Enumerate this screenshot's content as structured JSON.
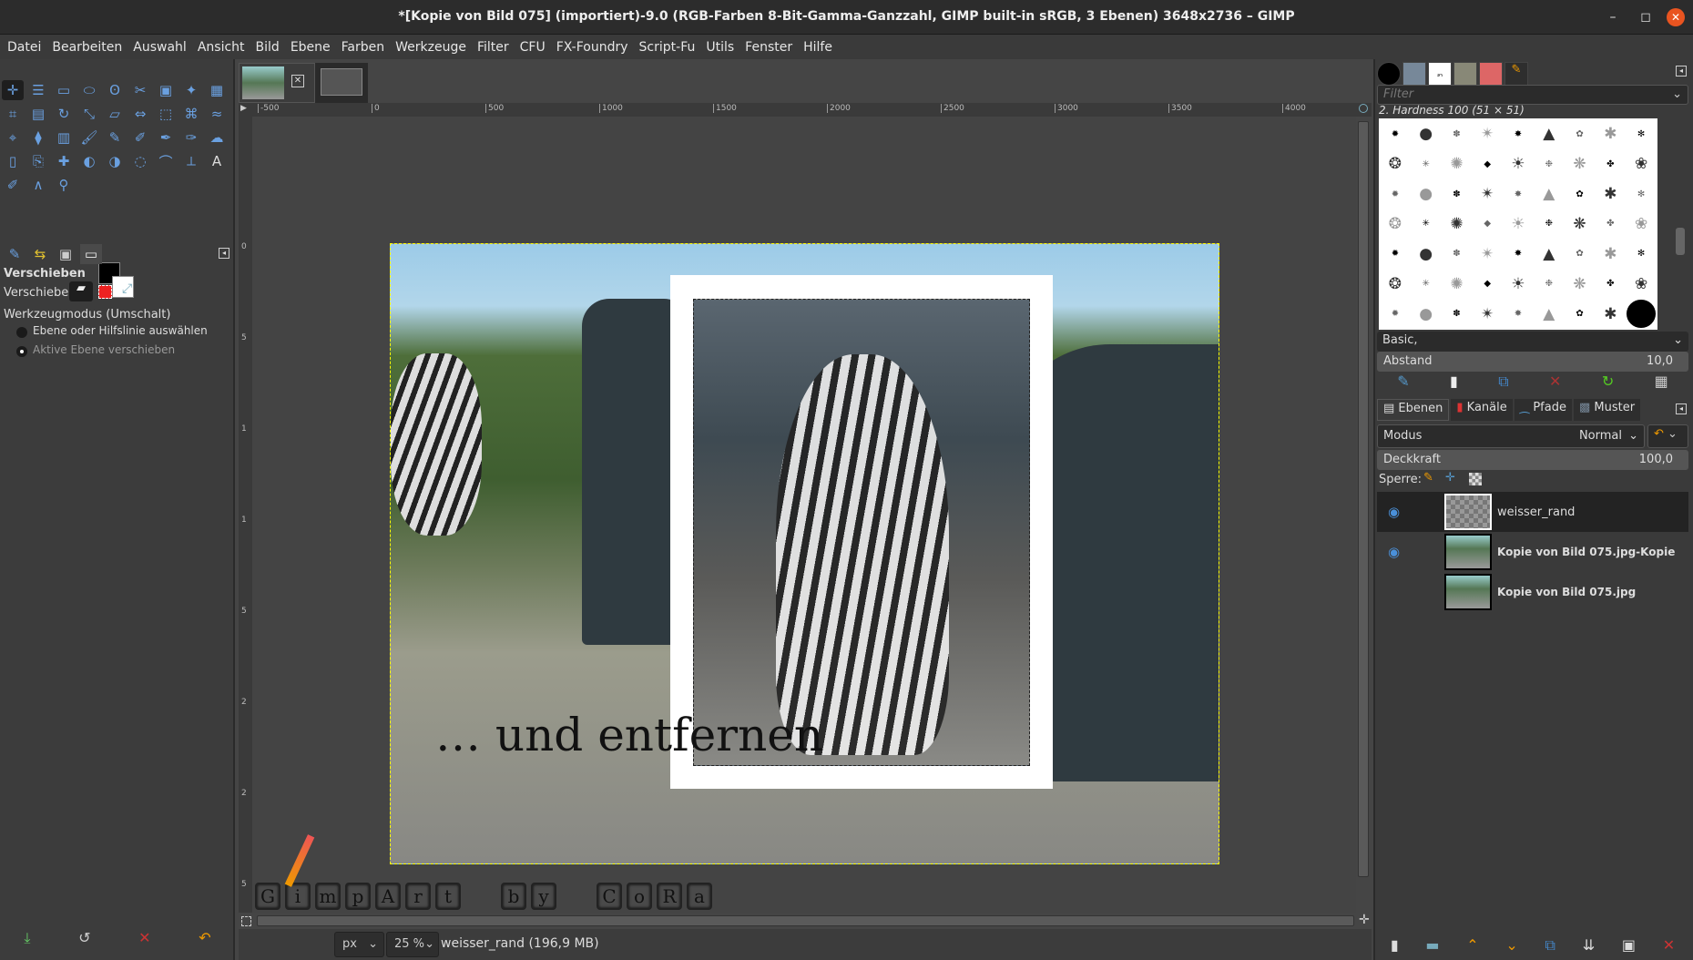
{
  "window": {
    "title": "*[Kopie von Bild 075] (importiert)-9.0 (RGB-Farben 8-Bit-Gamma-Ganzzahl, GIMP built-in sRGB, 3 Ebenen) 3648x2736 – GIMP",
    "minimize": "–",
    "maximize": "◻",
    "close": "✕"
  },
  "menu": [
    "Datei",
    "Bearbeiten",
    "Auswahl",
    "Ansicht",
    "Bild",
    "Ebene",
    "Farben",
    "Werkzeuge",
    "Filter",
    "CFU",
    "FX-Foundry",
    "Script-Fu",
    "Utils",
    "Fenster",
    "Hilfe"
  ],
  "ruler": {
    "top": [
      "-500",
      "0",
      "500",
      "1000",
      "1500",
      "2000",
      "2500",
      "3000",
      "3500",
      "4000"
    ],
    "left": [
      "0",
      "5",
      "1",
      "1",
      "5",
      "2",
      "2",
      "5"
    ]
  },
  "tool_options": {
    "title": "Verschieben",
    "move_label": "Verschieben:",
    "mode_label": "Werkzeugmodus (Umschalt)",
    "option1": "Ebene oder Hilfslinie auswählen",
    "option2": "Aktive Ebene verschieben"
  },
  "canvas": {
    "caption": "… und entfernen",
    "letters": [
      "G",
      "i",
      "m",
      "p",
      "A",
      "r",
      "t",
      "b",
      "y",
      "C",
      "o",
      "R",
      "a"
    ]
  },
  "status": {
    "unit": "px",
    "zoom": "25 %",
    "info": "weisser_rand (196,9 MB)"
  },
  "brushes": {
    "filter_placeholder": "Filter",
    "selected": "2. Hardness 100 (51 × 51)",
    "preset": "Basic,",
    "spacing_label": "Abstand",
    "spacing_value": "10,0"
  },
  "layers_tabs": [
    "Ebenen",
    "Kanäle",
    "Pfade",
    "Muster"
  ],
  "layers": {
    "mode_label": "Modus",
    "mode_value": "Normal",
    "opacity_label": "Deckkraft",
    "opacity_value": "100,0",
    "lock_label": "Sperre:",
    "items": [
      {
        "name": "weisser_rand",
        "visible": true
      },
      {
        "name": "Kopie von Bild 075.jpg-Kopie",
        "visible": true
      },
      {
        "name": "Kopie von Bild 075.jpg",
        "visible": false
      }
    ]
  }
}
